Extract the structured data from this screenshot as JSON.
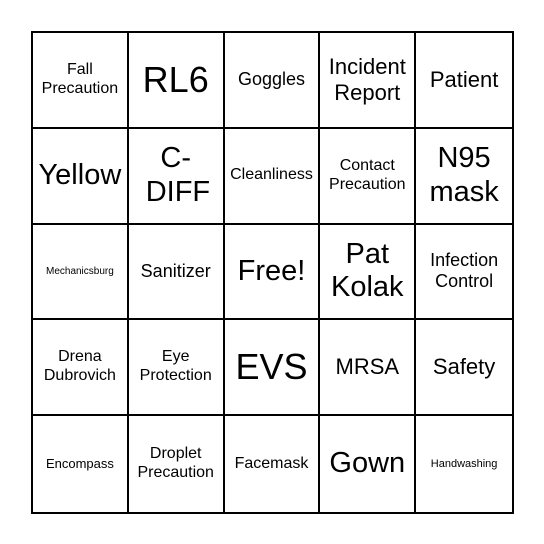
{
  "card": {
    "cells": [
      [
        "Fall Precaution",
        "RL6",
        "Goggles",
        "Incident Report",
        "Patient"
      ],
      [
        "Yellow",
        "C-DIFF",
        "Cleanliness",
        "Contact Precaution",
        "N95 mask"
      ],
      [
        "Mechanicsburg",
        "Sanitizer",
        "Free!",
        "Pat Kolak",
        "Infection Control"
      ],
      [
        "Drena Dubrovich",
        "Eye Protection",
        "EVS",
        "MRSA",
        "Safety"
      ],
      [
        "Encompass",
        "Droplet Precaution",
        "Facemask",
        "Gown",
        "Handwashing"
      ]
    ]
  }
}
